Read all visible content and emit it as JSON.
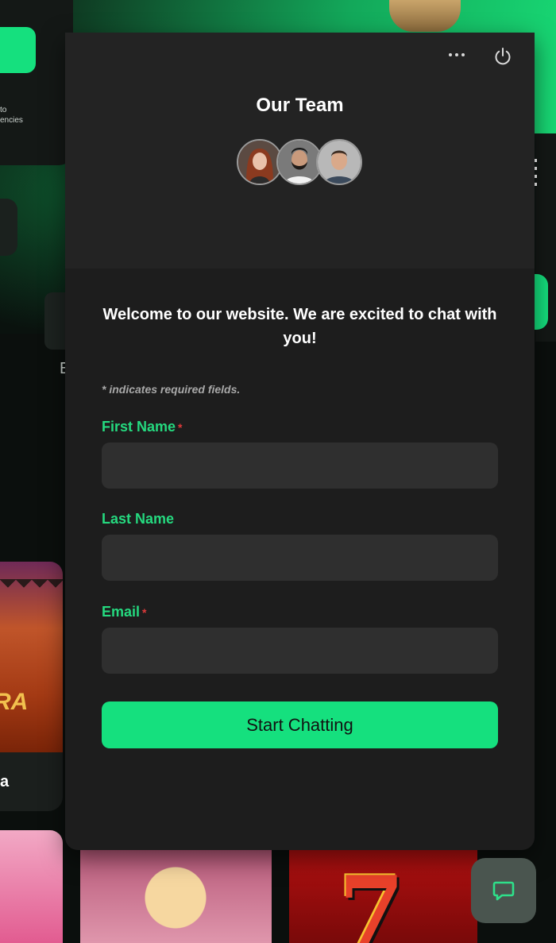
{
  "background": {
    "left_card_text_line1": "to",
    "left_card_text_line2": "encies",
    "left_letter": "E",
    "tile1_logo_text": "RA",
    "tile1_caption": "a"
  },
  "chat": {
    "title": "Our Team",
    "menu_icon": "more-horizontal-icon",
    "power_icon": "power-icon",
    "avatars": [
      {
        "name": "team-avatar-1"
      },
      {
        "name": "team-avatar-2"
      },
      {
        "name": "team-avatar-3"
      }
    ],
    "welcome": "Welcome to our website. We are excited to chat with you!",
    "required_note": "* indicates required fields.",
    "fields": {
      "first_name": {
        "label": "First Name",
        "required_mark": "*",
        "value": ""
      },
      "last_name": {
        "label": "Last Name",
        "value": ""
      },
      "email": {
        "label": "Email",
        "required_mark": "*",
        "value": ""
      }
    },
    "submit_label": "Start Chatting"
  },
  "launcher": {
    "icon": "chat-bubble-icon"
  },
  "colors": {
    "accent": "#15e07e",
    "label_green": "#25d97f",
    "required_red": "#e03a3a",
    "panel": "#1d1d1d",
    "header": "#232323",
    "input": "#2f2f2f"
  }
}
